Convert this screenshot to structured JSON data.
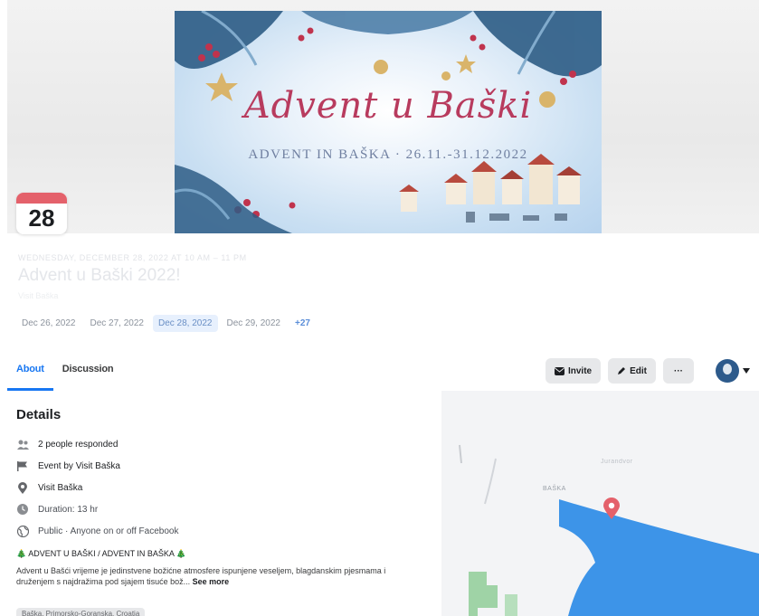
{
  "cover": {
    "title": "Advent u Baški",
    "subtitle": "ADVENT IN BAŠKA · 26.11.-31.12.2022",
    "accent_color": "#b83b5e"
  },
  "date_badge": {
    "day": "28",
    "accent_color": "#e4616b"
  },
  "event": {
    "time_line": "WEDNESDAY, DECEMBER 28, 2022 AT 10 AM – 11 PM",
    "title": "Advent u Baški 2022!",
    "host_line": "Visit Baška"
  },
  "dates": {
    "items": [
      "Dec 26, 2022",
      "Dec 27, 2022",
      "Dec 28, 2022",
      "Dec 29, 2022"
    ],
    "more": "+27",
    "active_index": 2
  },
  "tabs": {
    "about": "About",
    "discussion": "Discussion"
  },
  "actions": {
    "invite": "Invite",
    "edit": "Edit",
    "more": "···"
  },
  "details": {
    "heading": "Details",
    "responded": "2 people responded",
    "event_by": "Event by Visit Baška",
    "location": "Visit Baška",
    "duration": "Duration: 13 hr",
    "privacy": "Public · Anyone on or off Facebook",
    "description_title": "🎄 ADVENT U BAŠKI / ADVENT IN BAŠKA 🎄",
    "description": "Advent u Bašći vrijeme je jedinstvene božićne atmosfere ispunjene veseljem, blagdanskim pjesmama i druženjem s najdražima pod sjajem tisuće bož...",
    "see_more": "See more",
    "tag": "Baška, Primorsko-Goranska, Croatia"
  },
  "map": {
    "label_town": "BAŠKA",
    "label_road": "Jurandvor",
    "pin_color": "#e4616b",
    "sea_color": "#3d94e8"
  }
}
